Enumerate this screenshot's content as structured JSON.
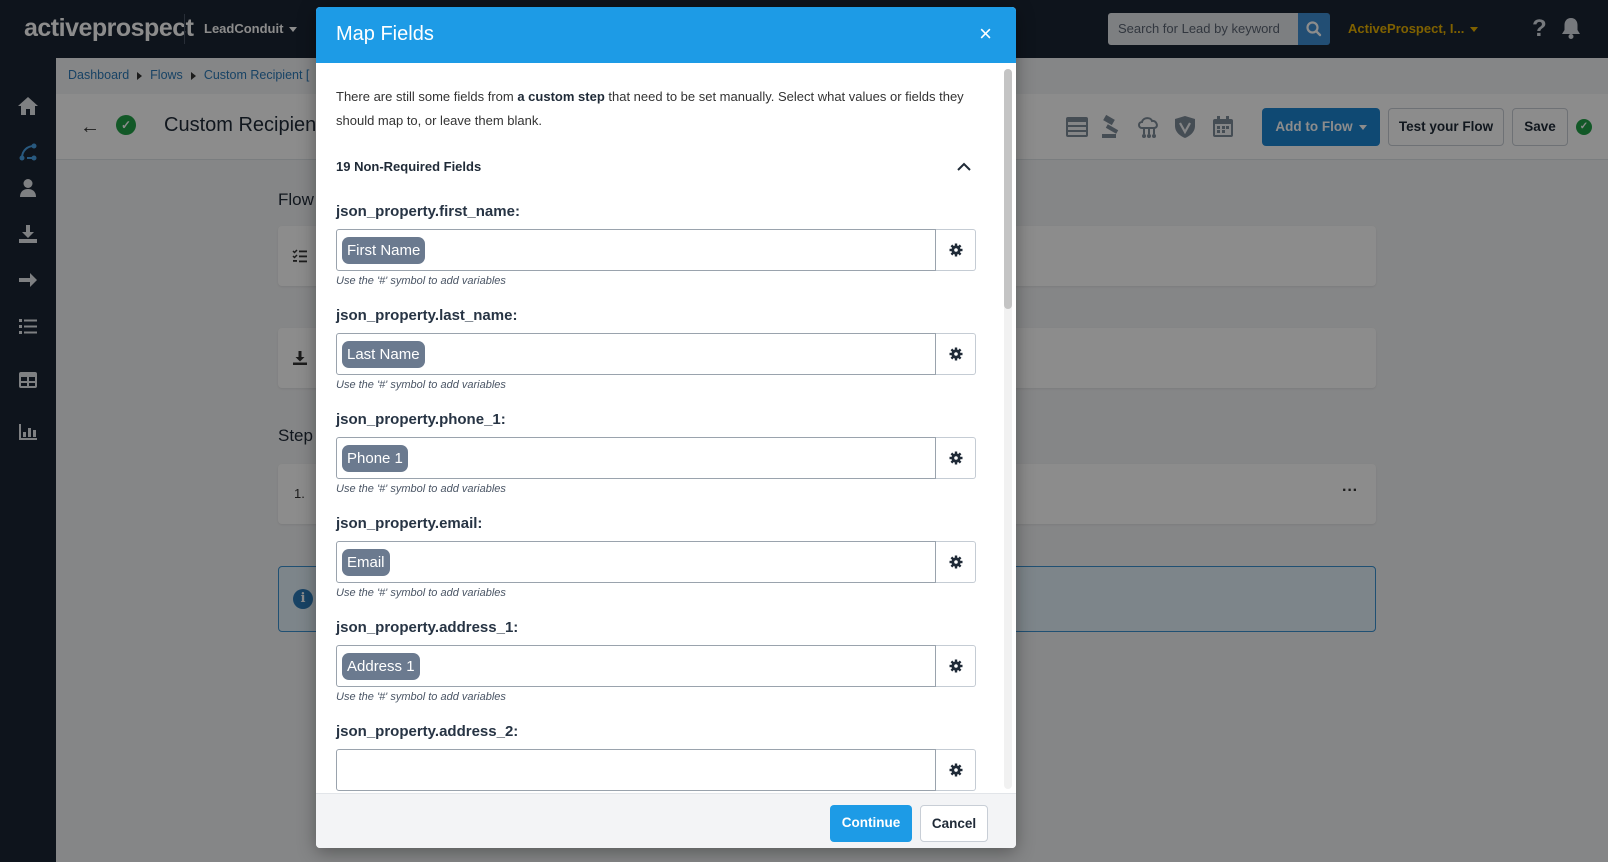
{
  "nav": {
    "logo": "activeprospect",
    "product": "LeadConduit",
    "search_placeholder": "Search for Lead by keyword",
    "account": "ActiveProspect, I...",
    "help": "?"
  },
  "breadcrumb": [
    "Dashboard",
    "Flows",
    "Custom Recipient ["
  ],
  "page": {
    "title": "Custom Recipient",
    "add_to_flow": "Add to Flow",
    "test_flow": "Test your Flow",
    "save": "Save",
    "flow_section": "Flow",
    "steps_section": "Step",
    "step_number": "1.",
    "ellipsis": "···",
    "info_icon": "i"
  },
  "modal": {
    "title": "Map Fields",
    "close": "×",
    "intro_pre": "There are still some fields from ",
    "intro_bold": "a custom step",
    "intro_post": " that need to be set manually. Select what values or fields they should map to, or leave them blank.",
    "fields_heading": "19 Non-Required Fields",
    "hint": "Use the '#' symbol to add variables",
    "fields": [
      {
        "label": "json_property.first_name:",
        "token": "First Name"
      },
      {
        "label": "json_property.last_name:",
        "token": "Last Name"
      },
      {
        "label": "json_property.phone_1:",
        "token": "Phone 1"
      },
      {
        "label": "json_property.email:",
        "token": "Email"
      },
      {
        "label": "json_property.address_1:",
        "token": "Address 1"
      },
      {
        "label": "json_property.address_2:",
        "token": ""
      }
    ],
    "continue": "Continue",
    "cancel": "Cancel"
  },
  "colors": {
    "nav_bg": "#1b2633",
    "modal_header": "#1d9be6",
    "primary_button": "#1d85d1",
    "account_text": "#e8b100",
    "success": "#21a147",
    "token_bg": "#6b7a8f"
  },
  "icons": [
    "home-icon",
    "flow-icon",
    "user-icon",
    "download-icon",
    "arrow-right-icon",
    "list-icon",
    "table-icon",
    "chart-icon",
    "search-icon",
    "bell-icon",
    "gear-icon",
    "chevron-up-icon",
    "close-icon",
    "back-arrow-icon",
    "check-circle-icon",
    "info-icon"
  ]
}
